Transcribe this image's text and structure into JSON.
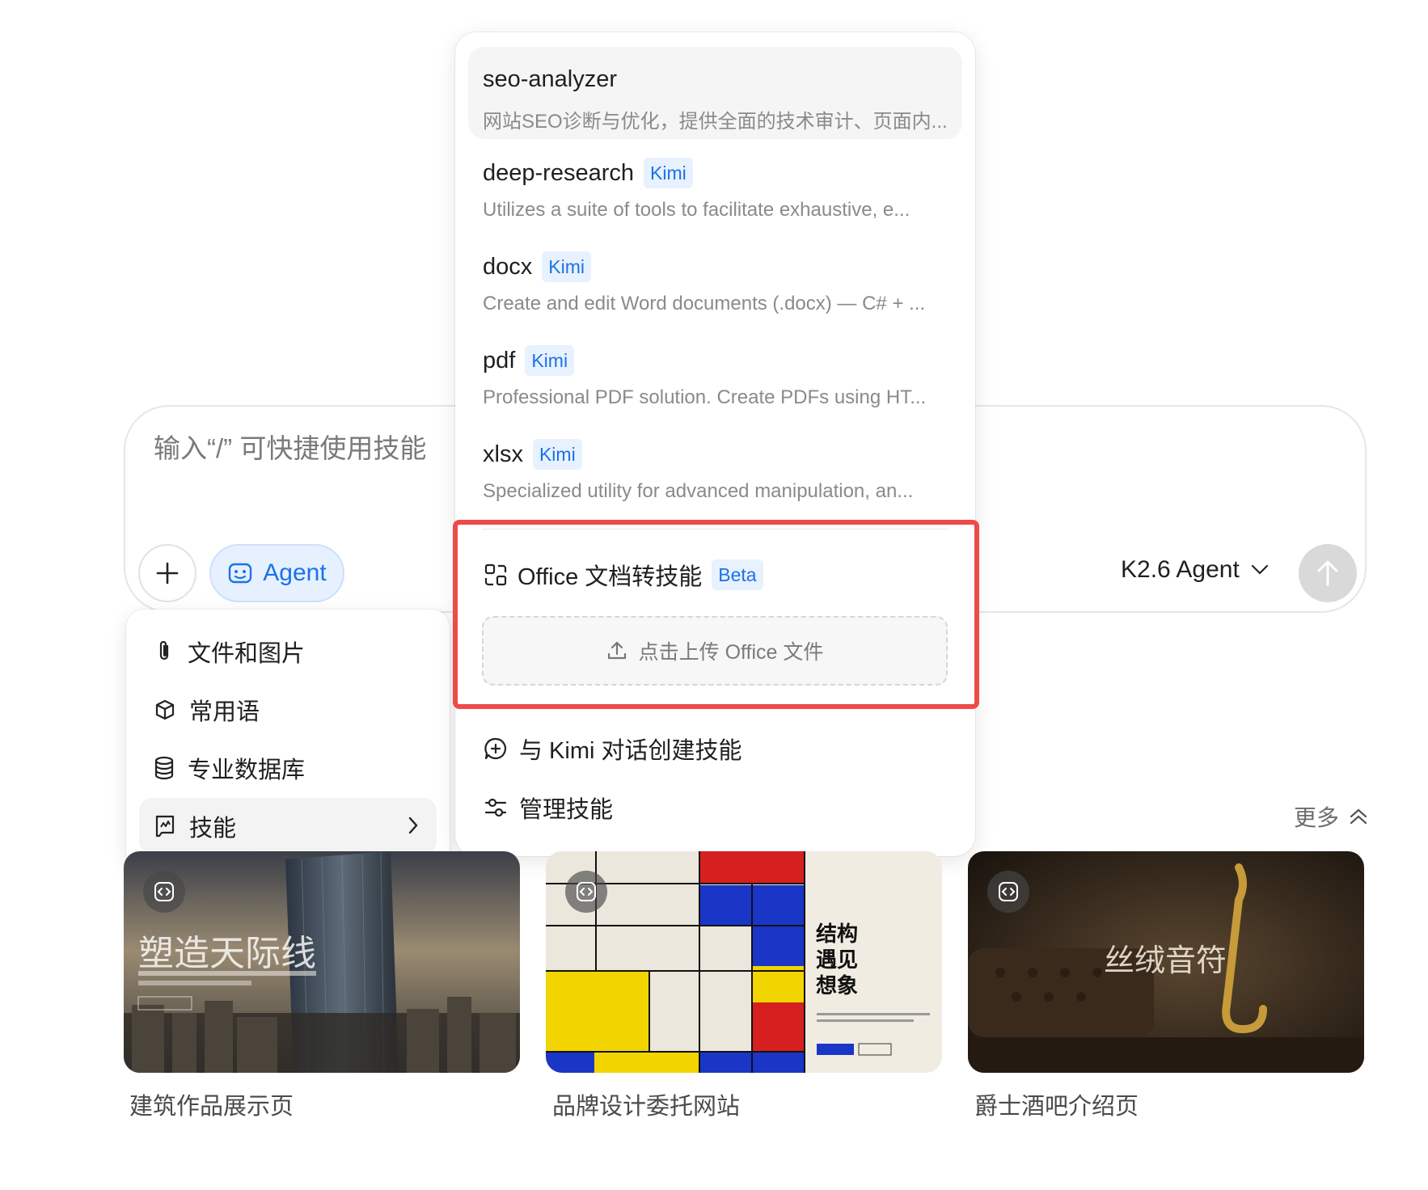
{
  "composer": {
    "placeholder": "输入“/” 可快捷使用技能",
    "agent_label": "Agent",
    "model_label": "K2.6 Agent"
  },
  "attach_menu": {
    "items": [
      {
        "label": "文件和图片",
        "icon": "paperclip-icon"
      },
      {
        "label": "常用语",
        "icon": "cube-icon"
      },
      {
        "label": "专业数据库",
        "icon": "database-icon"
      },
      {
        "label": "技能",
        "icon": "skill-icon"
      }
    ]
  },
  "skills": {
    "items": [
      {
        "name": "seo-analyzer",
        "tag": "",
        "desc": "网站SEO诊断与优化，提供全面的技术审计、页面内..."
      },
      {
        "name": "deep-research",
        "tag": "Kimi",
        "desc": "Utilizes a suite of tools to facilitate exhaustive, e..."
      },
      {
        "name": "docx",
        "tag": "Kimi",
        "desc": "Create and edit Word documents (.docx) — C# + ..."
      },
      {
        "name": "pdf",
        "tag": "Kimi",
        "desc": "Professional PDF solution. Create PDFs using HT..."
      },
      {
        "name": "xlsx",
        "tag": "Kimi",
        "desc": "Specialized utility for advanced manipulation, an..."
      }
    ],
    "office_label": "Office 文档转技能",
    "office_tag": "Beta",
    "upload_label": "点击上传 Office 文件",
    "create_label": "与 Kimi 对话创建技能",
    "manage_label": "管理技能"
  },
  "more_label": "更多",
  "cards": [
    {
      "label": "建筑作品展示页",
      "title": "塑造天际线"
    },
    {
      "label": "品牌设计委托网站",
      "title": "结构\n遇见\n想象"
    },
    {
      "label": "爵士酒吧介绍页",
      "title": "丝绒音符"
    }
  ]
}
